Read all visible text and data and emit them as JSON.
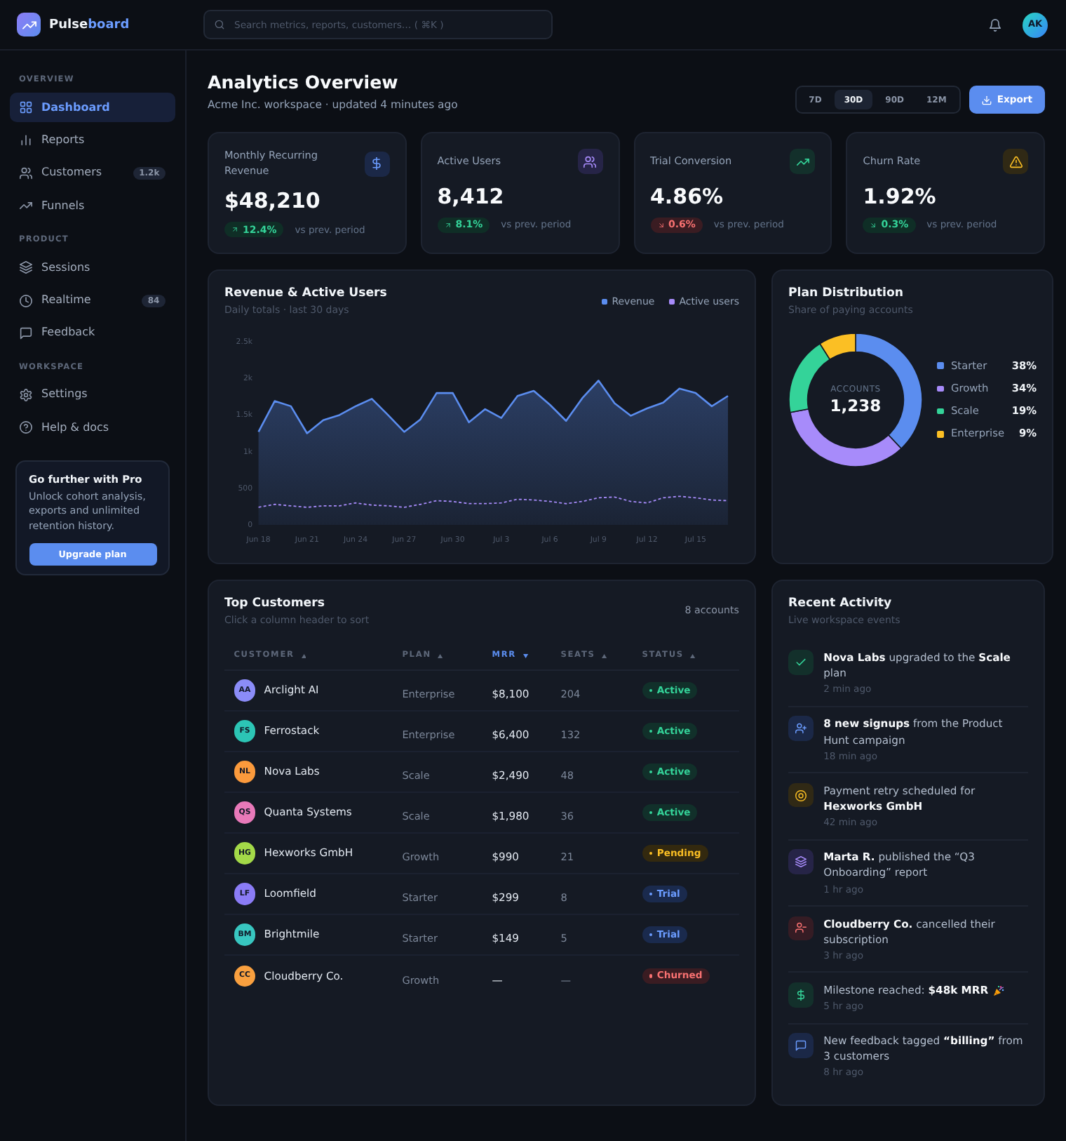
{
  "header": {
    "brand": {
      "name": "Pulse",
      "accent": "board"
    },
    "search": {
      "placeholder": "Search metrics, reports, customers… ( ⌘K )"
    },
    "avatar": {
      "initials": "AK"
    }
  },
  "sidebar": {
    "sections": [
      {
        "title": "OVERVIEW",
        "items": [
          {
            "label": "Dashboard",
            "selected": true
          },
          {
            "label": "Reports",
            "selected": false
          },
          {
            "label": "Customers",
            "selected": false,
            "badge": "1.2k"
          },
          {
            "label": "Funnels",
            "selected": false
          }
        ]
      },
      {
        "title": "PRODUCT",
        "items": [
          {
            "label": "Sessions",
            "selected": false
          },
          {
            "label": "Realtime",
            "selected": false,
            "badge": "84"
          },
          {
            "label": "Feedback",
            "selected": false
          }
        ]
      },
      {
        "title": "WORKSPACE",
        "items": [
          {
            "label": "Settings",
            "selected": false
          },
          {
            "label": "Help & docs",
            "selected": false
          }
        ]
      }
    ],
    "promo": {
      "title": "Go further with Pro",
      "text": "Unlock cohort analysis, exports and unlimited retention history.",
      "button": "Upgrade plan"
    }
  },
  "page": {
    "title": "Analytics Overview",
    "subtitle": "Acme Inc. workspace · updated 4 minutes ago",
    "ranges": [
      {
        "label": "7D",
        "selected": false
      },
      {
        "label": "30D",
        "selected": true
      },
      {
        "label": "90D",
        "selected": false
      },
      {
        "label": "12M",
        "selected": false
      }
    ],
    "export_button": "Export"
  },
  "kpis": [
    {
      "label": "Monthly Recurring Revenue",
      "value": "$48,210",
      "delta": {
        "text": "12.4%",
        "increase": true,
        "favorable": true
      },
      "comparison": "vs prev. period"
    },
    {
      "label": "Active Users",
      "value": "8,412",
      "delta": {
        "text": "8.1%",
        "increase": true,
        "favorable": true
      },
      "comparison": "vs prev. period"
    },
    {
      "label": "Trial Conversion",
      "value": "4.86%",
      "delta": {
        "text": "0.6%",
        "increase": false,
        "favorable": false
      },
      "comparison": "vs prev. period"
    },
    {
      "label": "Churn Rate",
      "value": "1.92%",
      "delta": {
        "text": "0.3%",
        "increase": false,
        "favorable": true
      },
      "comparison": "vs prev. period"
    }
  ],
  "revenue_chart": {
    "title": "Revenue & Active Users",
    "subtitle": "Daily totals · last 30 days",
    "chart_data": {
      "type": "area",
      "categories": [
        "Jun 18",
        null,
        null,
        "Jun 21",
        null,
        null,
        "Jun 24",
        null,
        null,
        "Jun 27",
        null,
        null,
        "Jun 30",
        null,
        null,
        "Jul 3",
        null,
        null,
        "Jul 6",
        null,
        null,
        "Jul 9",
        null,
        null,
        "Jul 12",
        null,
        null,
        "Jul 15",
        null,
        null
      ],
      "series": [
        {
          "name": "Revenue",
          "color": "#5b8def",
          "values": [
            1270,
            1690,
            1620,
            1250,
            1430,
            1500,
            1620,
            1720,
            1500,
            1270,
            1440,
            1800,
            1800,
            1400,
            1580,
            1460,
            1760,
            1830,
            1640,
            1420,
            1730,
            1970,
            1660,
            1490,
            1590,
            1670,
            1860,
            1800,
            1620,
            1760
          ]
        },
        {
          "name": "Active users",
          "type": "line",
          "line_style": "dashed",
          "color": "#a78bfa",
          "values": [
            240,
            280,
            260,
            240,
            260,
            260,
            300,
            270,
            260,
            240,
            280,
            330,
            320,
            290,
            290,
            300,
            350,
            340,
            320,
            290,
            320,
            370,
            380,
            320,
            300,
            370,
            390,
            370,
            340,
            330
          ]
        }
      ],
      "ylim": [
        0,
        2500
      ],
      "yticks": [
        {
          "value": 0,
          "label": "0"
        },
        {
          "value": 500,
          "label": "500"
        },
        {
          "value": 1000,
          "label": "1k"
        },
        {
          "value": 1500,
          "label": "1.5k"
        },
        {
          "value": 2000,
          "label": "2k"
        },
        {
          "value": 2500,
          "label": "2.5k"
        }
      ]
    }
  },
  "plan_distribution": {
    "title": "Plan Distribution",
    "subtitle": "Share of paying accounts",
    "center_label": "ACCOUNTS",
    "center_value": "1,238",
    "chart_data": {
      "type": "donut",
      "categories": [
        "Starter",
        "Growth",
        "Scale",
        "Enterprise"
      ],
      "values": [
        38,
        34,
        19,
        9
      ],
      "colors": [
        "#5b8def",
        "#a78bfa",
        "#34d399",
        "#fbbf24"
      ],
      "value_labels": [
        "38%",
        "34%",
        "19%",
        "9%"
      ]
    }
  },
  "top_customers": {
    "title": "Top Customers",
    "subtitle": "Click a column header to sort",
    "count": "8 accounts",
    "columns": [
      {
        "label": "CUSTOMER",
        "descending": false,
        "selected": false
      },
      {
        "label": "PLAN",
        "descending": false,
        "selected": false
      },
      {
        "label": "MRR",
        "descending": true,
        "selected": true
      },
      {
        "label": "SEATS",
        "descending": false,
        "selected": false
      },
      {
        "label": "STATUS",
        "descending": false,
        "selected": false
      }
    ],
    "rows": [
      {
        "initials": "AA",
        "name": "Arclight AI",
        "color": "#8b8cf8",
        "plan": "Enterprise",
        "mrr": "$8,100",
        "seats": "204",
        "status": {
          "label": "Active",
          "kind": "active"
        }
      },
      {
        "initials": "FS",
        "name": "Ferrostack",
        "color": "#2cc5b5",
        "plan": "Enterprise",
        "mrr": "$6,400",
        "seats": "132",
        "status": {
          "label": "Active",
          "kind": "active"
        }
      },
      {
        "initials": "NL",
        "name": "Nova Labs",
        "color": "#fb9a3c",
        "plan": "Scale",
        "mrr": "$2,490",
        "seats": "48",
        "status": {
          "label": "Active",
          "kind": "active"
        }
      },
      {
        "initials": "QS",
        "name": "Quanta Systems",
        "color": "#e879b9",
        "plan": "Scale",
        "mrr": "$1,980",
        "seats": "36",
        "status": {
          "label": "Active",
          "kind": "active"
        }
      },
      {
        "initials": "HG",
        "name": "Hexworks GmbH",
        "color": "#a3d948",
        "plan": "Growth",
        "mrr": "$990",
        "seats": "21",
        "status": {
          "label": "Pending",
          "kind": "pending"
        }
      },
      {
        "initials": "LF",
        "name": "Loomfield",
        "color": "#8b7cf6",
        "plan": "Starter",
        "mrr": "$299",
        "seats": "8",
        "status": {
          "label": "Trial",
          "kind": "trial"
        }
      },
      {
        "initials": "BM",
        "name": "Brightmile",
        "color": "#38c6c0",
        "plan": "Starter",
        "mrr": "$149",
        "seats": "5",
        "status": {
          "label": "Trial",
          "kind": "trial"
        }
      },
      {
        "initials": "CC",
        "name": "Cloudberry Co.",
        "color": "#f9a03f",
        "plan": "Growth",
        "mrr": "—",
        "seats": "—",
        "status": {
          "label": "Churned",
          "kind": "churned"
        }
      }
    ]
  },
  "recent_activity": {
    "title": "Recent Activity",
    "subtitle": "Live workspace events",
    "items": [
      {
        "kind": "upgrade",
        "text": "**Nova Labs** upgraded to the **Scale** plan",
        "time": "2 min ago"
      },
      {
        "kind": "signup",
        "text": "**8 new signups** from the Product Hunt campaign",
        "time": "18 min ago"
      },
      {
        "kind": "payment",
        "text": "Payment retry scheduled for **Hexworks GmbH**",
        "time": "42 min ago"
      },
      {
        "kind": "report",
        "text": "**Marta R.** published the “Q3 Onboarding” report",
        "time": "1 hr ago"
      },
      {
        "kind": "cancellation",
        "text": "**Cloudberry Co.** cancelled their subscription",
        "time": "3 hr ago"
      },
      {
        "kind": "milestone",
        "text": "Milestone reached: **$48k MRR**",
        "time": "5 hr ago"
      },
      {
        "kind": "feedback",
        "text": "New feedback tagged **“billing”** from 3 customers",
        "time": "8 hr ago"
      }
    ]
  }
}
